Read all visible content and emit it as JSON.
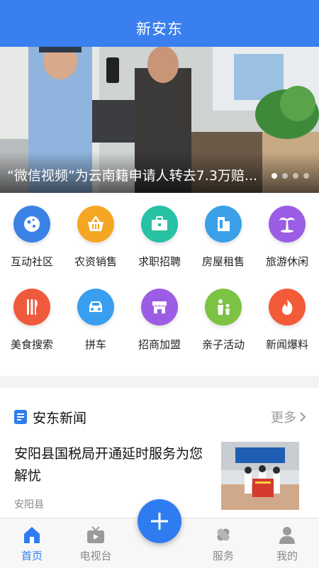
{
  "header": {
    "title": "新安东"
  },
  "banner": {
    "caption": "“微信视频”为云南籍申请人转去7.3万赔...",
    "slide_count": 4,
    "active_slide": 1
  },
  "services": [
    {
      "label": "互动社区",
      "icon": "planet-icon",
      "color": "#3b82e6"
    },
    {
      "label": "农资销售",
      "icon": "basket-icon",
      "color": "#f5a623"
    },
    {
      "label": "求职招聘",
      "icon": "briefcase-icon",
      "color": "#27c1a3"
    },
    {
      "label": "房屋租售",
      "icon": "building-icon",
      "color": "#3aa0e8"
    },
    {
      "label": "旅游休闲",
      "icon": "palm-tree-icon",
      "color": "#9b5de5"
    },
    {
      "label": "美食搜索",
      "icon": "fork-knife-icon",
      "color": "#f05a3c"
    },
    {
      "label": "拼车",
      "icon": "car-icon",
      "color": "#3a9ef0"
    },
    {
      "label": "招商加盟",
      "icon": "storefront-icon",
      "color": "#9b5de5"
    },
    {
      "label": "亲子活动",
      "icon": "parent-child-icon",
      "color": "#7cc343"
    },
    {
      "label": "新闻爆料",
      "icon": "flame-icon",
      "color": "#f25a38"
    }
  ],
  "news": {
    "section_title": "安东新闻",
    "more_label": "更多",
    "items": [
      {
        "title": "安阳县国税局开通延时服务为您解忧",
        "source": "安阳县"
      }
    ]
  },
  "tabbar": {
    "items": [
      {
        "label": "首页",
        "icon": "home-icon",
        "active": true
      },
      {
        "label": "电视台",
        "icon": "tv-icon",
        "active": false
      },
      {
        "label": "服务",
        "icon": "service-icon",
        "active": false
      },
      {
        "label": "我的",
        "icon": "user-icon",
        "active": false
      }
    ],
    "fab_icon": "plus-icon"
  },
  "colors": {
    "primary": "#3a7ff0",
    "active_tab": "#2f7cf0",
    "inactive_tab": "#888888"
  }
}
